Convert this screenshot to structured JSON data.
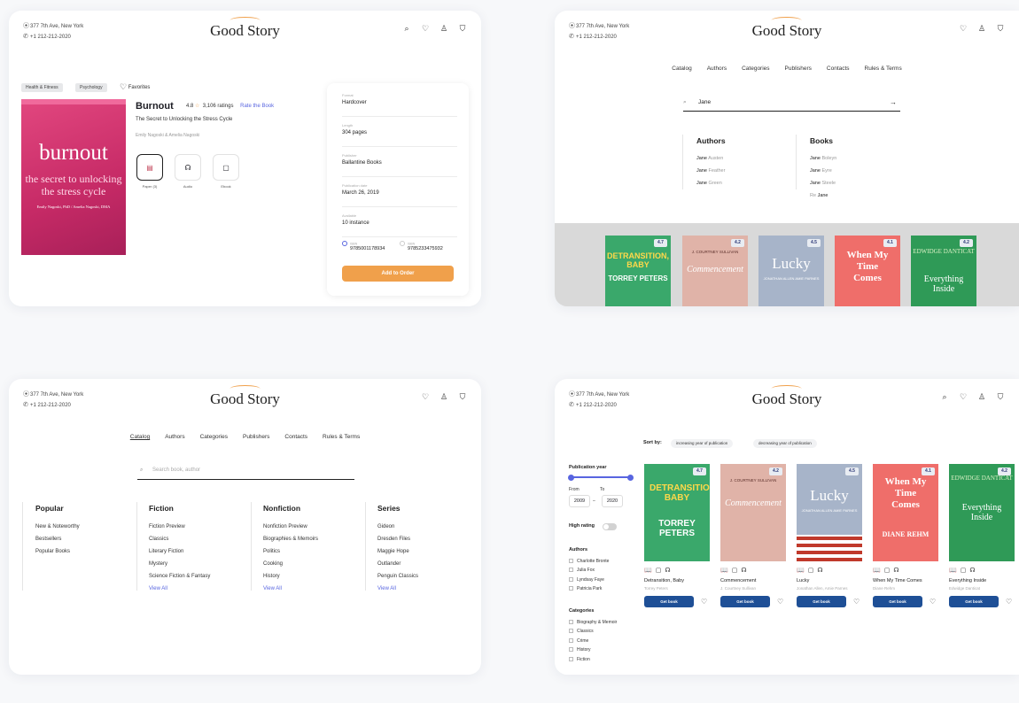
{
  "header": {
    "address": "377 7th Ave, New York",
    "phone": "+1 212-212-2020",
    "logo": "Good Story",
    "icons": [
      "search-icon",
      "heart-icon",
      "user-icon",
      "bag-icon"
    ]
  },
  "nav": [
    "Catalog",
    "Authors",
    "Categories",
    "Publishers",
    "Contacts",
    "Rules & Terms"
  ],
  "product": {
    "tags": [
      "Health & Fitness",
      "Psychology"
    ],
    "favorites": "Favorites",
    "title": "Burnout",
    "rating": "4.8",
    "ratings_count": "3,106 ratings",
    "rate_link": "Rate the Book",
    "subtitle": "The Secret to Unlocking the Stress Cycle",
    "authors": "Emily Nagoski  &  Amelia Nagoski",
    "cover": {
      "title": "burnout",
      "sub": "the secret to unlocking the stress cycle",
      "authors": "Emily Nagoski, PhD / Amelia Nagoski, DMA"
    },
    "formats": [
      {
        "label": "Paper (3)"
      },
      {
        "label": "Audio"
      },
      {
        "label": "Ebook"
      }
    ],
    "details": [
      {
        "key": "Format",
        "value": "Hardcover"
      },
      {
        "key": "Length",
        "value": "304 pages"
      },
      {
        "key": "Publisher",
        "value": "Ballantine Books"
      },
      {
        "key": "Publication date",
        "value": "March 26, 2019"
      },
      {
        "key": "Available",
        "value": "10 instance"
      }
    ],
    "isbn": [
      {
        "key": "ISBN",
        "value": "9785001178934"
      },
      {
        "key": "ISBN",
        "value": "9785233475932"
      }
    ],
    "order_button": "Add to Order"
  },
  "search_results": {
    "query": "Jane",
    "authors_title": "Authors",
    "authors": [
      {
        "b": "Jane",
        "r": " Austen"
      },
      {
        "b": "Jane",
        "r": " Feather"
      },
      {
        "b": "Jane",
        "r": " Green"
      }
    ],
    "books_title": "Books",
    "books": [
      {
        "b": "",
        "r": "Jane Boleyn"
      },
      {
        "b": "",
        "r": "Jane Eyre"
      },
      {
        "b": "",
        "r": "Jane Steele"
      },
      {
        "b": "Jane",
        "r": "Re "
      }
    ],
    "arrow": "→"
  },
  "menu": {
    "search_placeholder": "Search book, author",
    "columns": [
      {
        "title": "Popular",
        "items": [
          "New & Noteworthy",
          "Bestsellers",
          "Popular Books"
        ]
      },
      {
        "title": "Fiction",
        "items": [
          "Fiction Preview",
          "Classics",
          "Literary Fiction",
          "Mystery",
          "Science Fiction & Fantasy"
        ],
        "view_all": "View All"
      },
      {
        "title": "Nonfiction",
        "items": [
          "Nonfiction Preview",
          "Biographies & Memoirs",
          "Politics",
          "Cooking",
          "History"
        ],
        "view_all": "View All"
      },
      {
        "title": "Series",
        "items": [
          "Gideon",
          "Dresden Files",
          "Maggie Hope",
          "Outlander",
          "Penguin Classics"
        ],
        "view_all": "View All"
      }
    ]
  },
  "catalog": {
    "sort_label": "Sort by:",
    "sort_options": [
      "increasing year of publication",
      "decreasing year of publication"
    ],
    "filters": {
      "pub_year": "Publication year",
      "from": "From",
      "to": "To",
      "year_from": "2009",
      "year_to": "2020",
      "dash": "–",
      "high_rating": "High rating",
      "authors_title": "Authors",
      "authors": [
        "Charlotte Bronte",
        "Julia Fox",
        "Lyndsay Faye",
        "Patricia Park"
      ],
      "categories_title": "Categories",
      "categories": [
        "Biography & Memoir",
        "Classics",
        "Crime",
        "History",
        "Fiction"
      ]
    },
    "books": [
      {
        "title": "Detransition, Baby",
        "author": "Torrey Peters",
        "rating": "4.7",
        "cover_text": "DETRANSITION, BABY",
        "cover_author": "TORREY PETERS",
        "color": "#3aa86b"
      },
      {
        "title": "Commencement",
        "author": "J. Courtney Sullivan",
        "rating": "4.2",
        "cover_text": "Commencement",
        "cover_author": "J. COURTNEY SULLIVAN",
        "color": "#e0b3a8"
      },
      {
        "title": "Lucky",
        "author": "Jonathan Allen, Amie Parnes",
        "rating": "4.5",
        "cover_text": "Lucky",
        "cover_author": "JONATHAN ALLEN AMIE PARNES",
        "color": "#a7b4c9"
      },
      {
        "title": "When My Time Comes",
        "author": "Diane Rehm",
        "rating": "4.1",
        "cover_text": "When My Time Comes",
        "cover_author": "DIANE REHM",
        "color": "#ef6e6a"
      },
      {
        "title": "Everything Inside",
        "author": "Edwidge Danticat",
        "rating": "4.2",
        "cover_text": "Everything Inside",
        "cover_author": "EDWIDGE DANTICAT",
        "color": "#2f9a57"
      }
    ],
    "get_book": "Get book"
  }
}
